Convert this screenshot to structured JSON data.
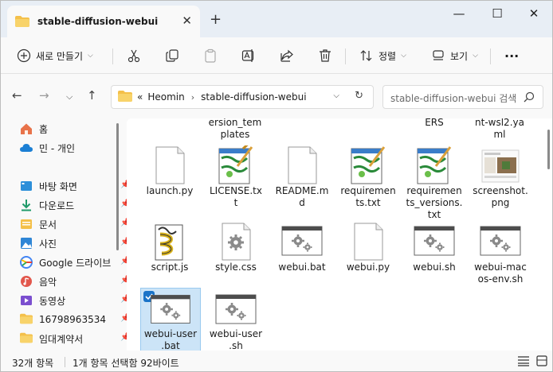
{
  "window": {
    "tab_title": "stable-diffusion-webui",
    "tab_close": "✕",
    "new_tab": "+",
    "minimize": "—",
    "maximize": "☐",
    "close": "✕"
  },
  "toolbar": {
    "new_label": "새로 만들기",
    "sort_label": "정렬",
    "view_label": "보기",
    "more": "···",
    "caret": "⌵"
  },
  "address": {
    "overflow": "«",
    "crumbs": [
      "Heomin",
      "stable-diffusion-webui"
    ],
    "separator": "›",
    "dropdown": "⌵",
    "refresh": "↻",
    "back": "←",
    "forward": "→",
    "recent": "⌵",
    "up": "↑"
  },
  "search": {
    "placeholder": "stable-diffusion-webui 검색"
  },
  "sidebar": {
    "items": [
      {
        "label": "홈",
        "icon": "home-icon"
      },
      {
        "label": "민 - 개인",
        "icon": "cloud-icon"
      },
      {
        "label": "바탕 화면",
        "icon": "desktop-icon",
        "pinned": true
      },
      {
        "label": "다운로드",
        "icon": "download-icon",
        "pinned": true
      },
      {
        "label": "문서",
        "icon": "document-icon",
        "pinned": true
      },
      {
        "label": "사진",
        "icon": "pictures-icon",
        "pinned": true
      },
      {
        "label": "Google 드라이브",
        "icon": "google-drive-icon",
        "pinned": true
      },
      {
        "label": "음악",
        "icon": "music-icon",
        "pinned": true
      },
      {
        "label": "동영상",
        "icon": "video-icon",
        "pinned": true
      },
      {
        "label": "16798963534",
        "icon": "folder-icon",
        "pinned": true
      },
      {
        "label": "임대계약서",
        "icon": "folder-icon",
        "pinned": true
      }
    ]
  },
  "files": {
    "partial": [
      {
        "name": "ersion_tem plates"
      },
      {
        "name": "ERS"
      },
      {
        "name": "nt-wsl2.ya ml"
      }
    ],
    "row1": [
      {
        "name": "launch.py",
        "icon": "blank-file-icon"
      },
      {
        "name": "LICENSE.tx t",
        "icon": "notepad-file-icon"
      },
      {
        "name": "README.m d",
        "icon": "blank-file-icon"
      },
      {
        "name": "requiremen ts.txt",
        "icon": "notepad-file-icon"
      },
      {
        "name": "requiremen ts_versions. txt",
        "icon": "notepad-file-icon"
      },
      {
        "name": "screenshot. png",
        "icon": "image-thumb-icon"
      }
    ],
    "row2": [
      {
        "name": "script.js",
        "icon": "script-file-icon"
      },
      {
        "name": "style.css",
        "icon": "gear-file-icon"
      },
      {
        "name": "webui.bat",
        "icon": "batch-file-icon"
      },
      {
        "name": "webui.py",
        "icon": "blank-file-icon"
      },
      {
        "name": "webui.sh",
        "icon": "batch-file-icon"
      },
      {
        "name": "webui-mac os-env.sh",
        "icon": "batch-file-icon"
      }
    ],
    "row3": [
      {
        "name": "webui-user .bat",
        "icon": "batch-file-icon",
        "selected": true
      },
      {
        "name": "webui-user .sh",
        "icon": "batch-file-icon"
      }
    ]
  },
  "status": {
    "count": "32개 항목",
    "selection": "1개 항목 선택함 92바이트"
  },
  "colors": {
    "accent": "#1a73c8",
    "folder": "#f4c04a",
    "selection": "#cce4f7"
  }
}
